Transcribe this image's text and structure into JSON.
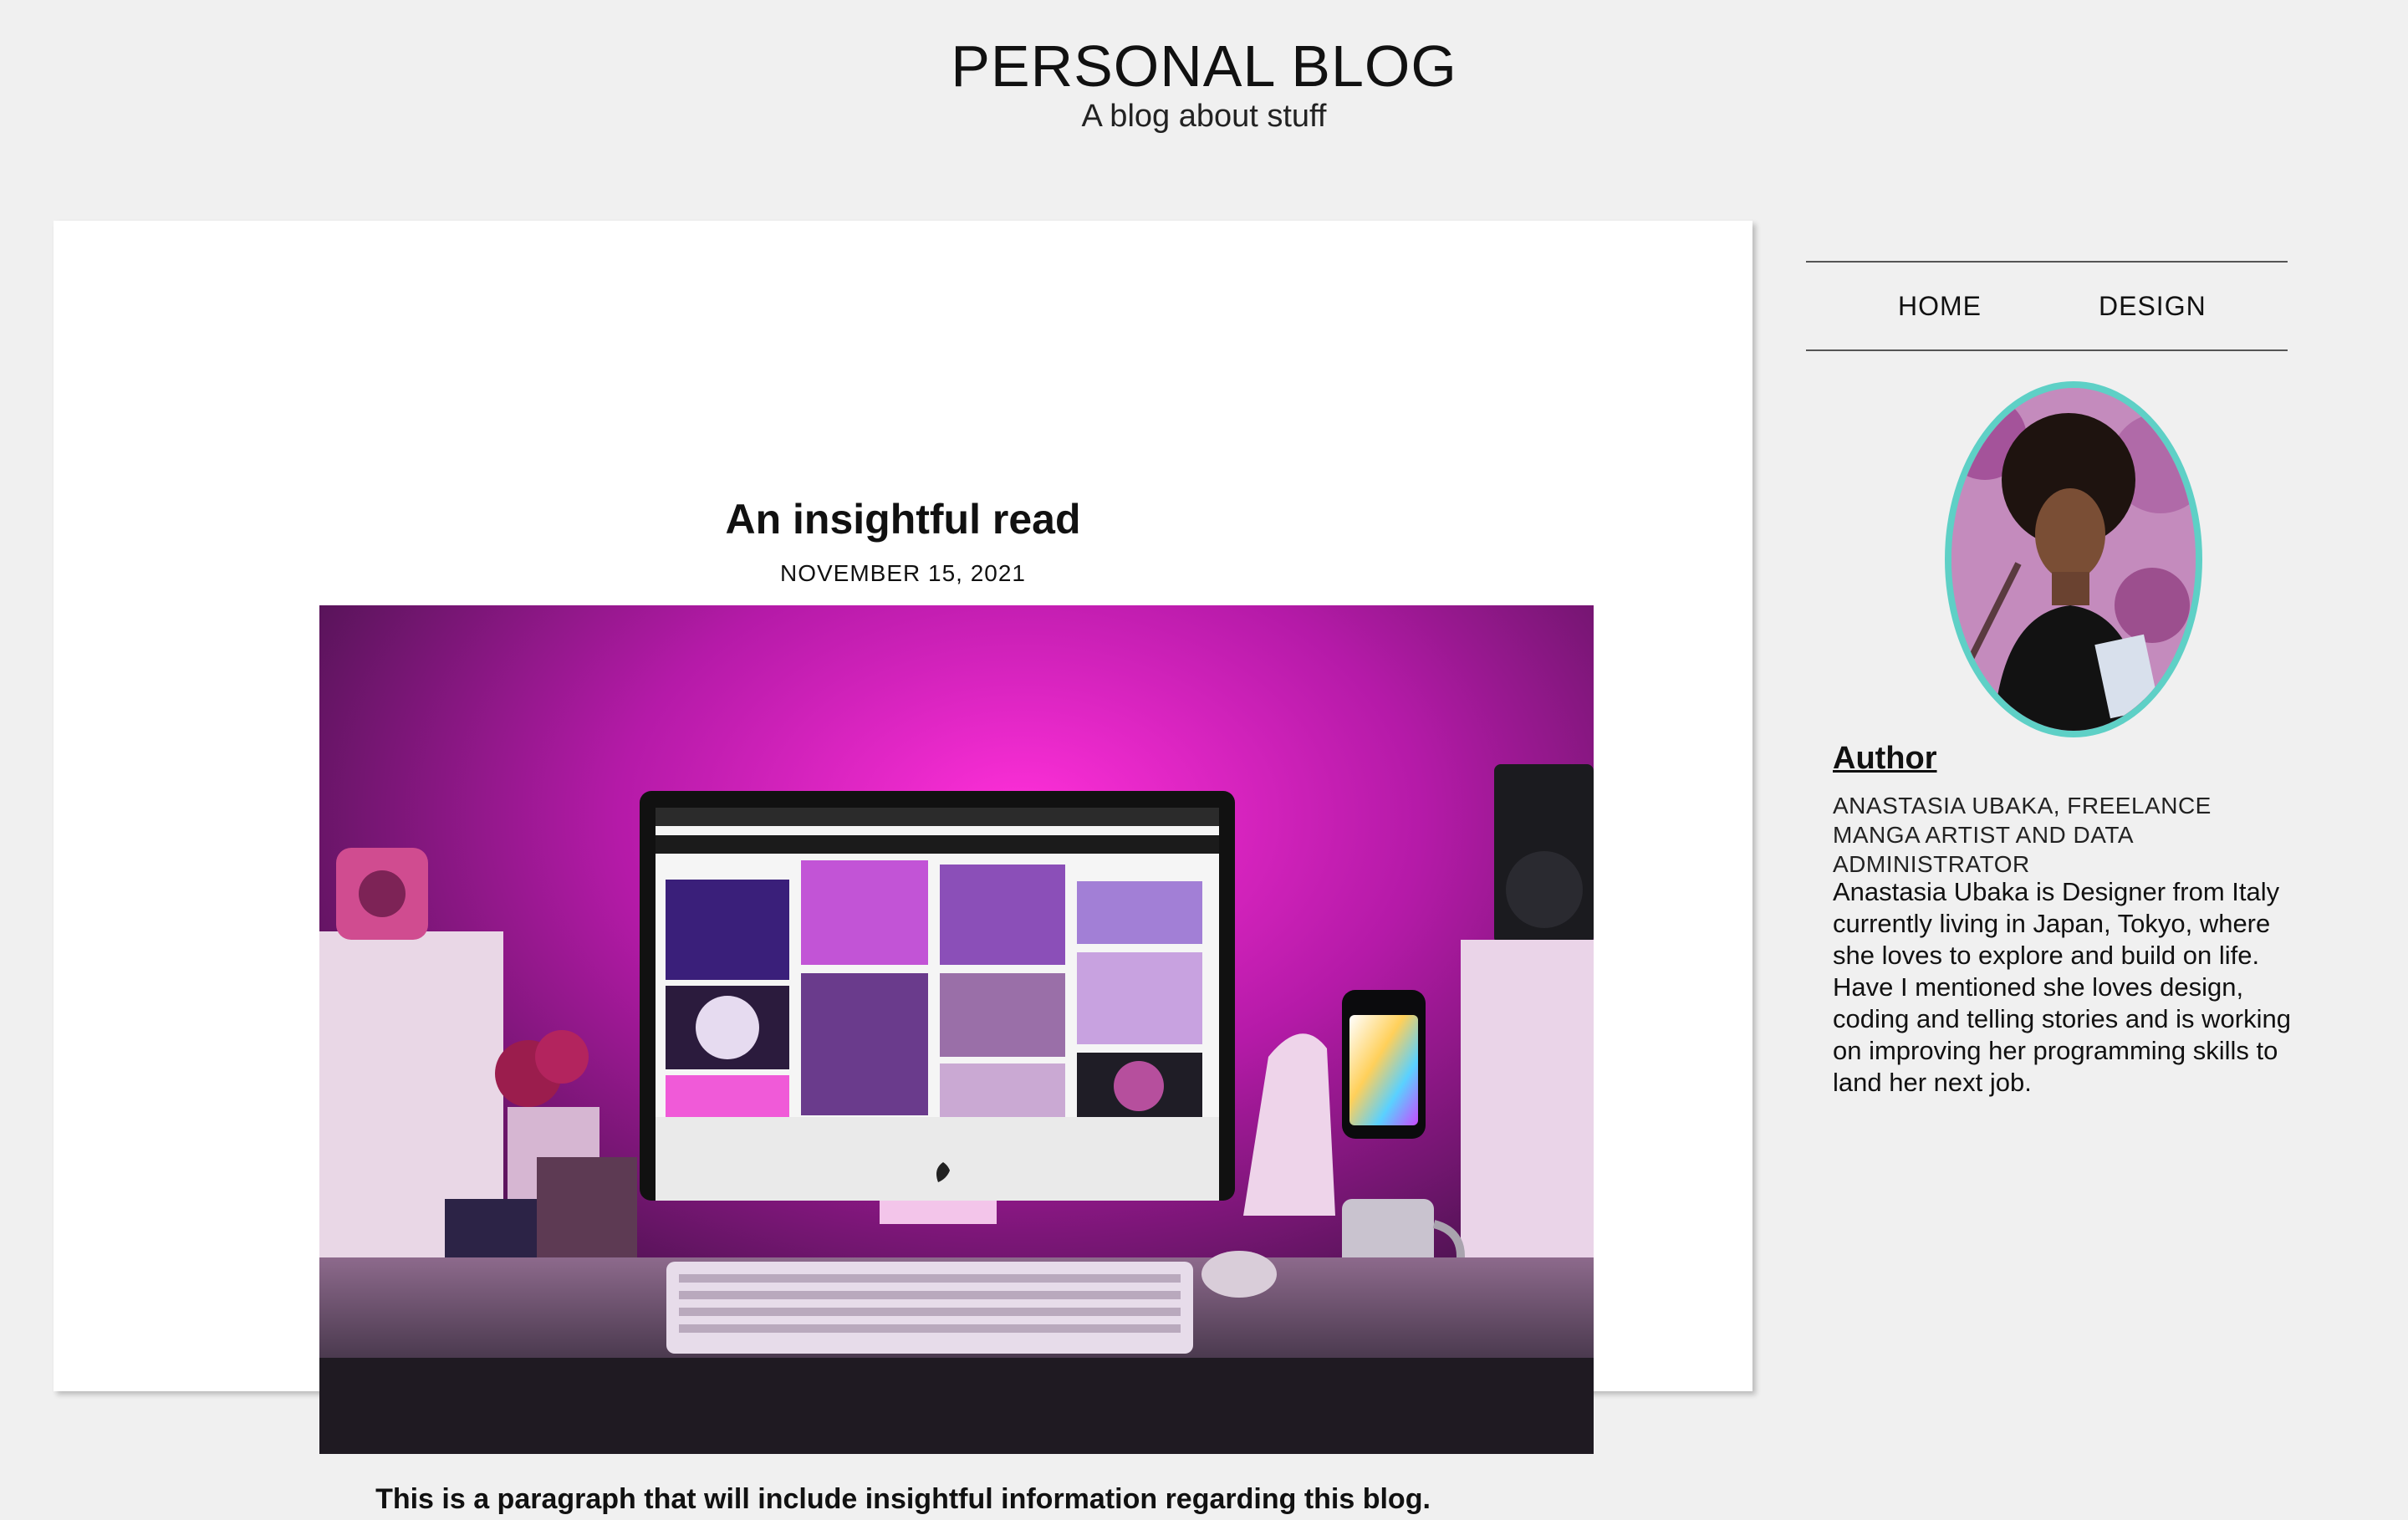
{
  "header": {
    "title": "PERSONAL BLOG",
    "subtitle": "A blog about stuff"
  },
  "post": {
    "title": "An insightful read",
    "date": "NOVEMBER 15, 2021",
    "excerpt": "This is a paragraph that will include insightful information regarding this blog."
  },
  "nav": {
    "items": [
      {
        "label": "HOME"
      },
      {
        "label": "DESIGN"
      }
    ]
  },
  "sidebar": {
    "author_heading": "Author",
    "author_name": "ANASTASIA UBAKA, FREELANCE MANGA ARTIST AND DATA ADMINISTRATOR",
    "author_bio": "Anastasia Ubaka is Designer from Italy currently living in Japan, Tokyo, where she loves to explore and build on life. Have I mentioned she loves design, coding and telling stories and is working on improving her programming skills to land her next job."
  },
  "colors": {
    "background": "#f0f0f0",
    "card": "#ffffff",
    "avatar_border": "#5ed0c6",
    "accent_magenta": "#e21fc8"
  }
}
